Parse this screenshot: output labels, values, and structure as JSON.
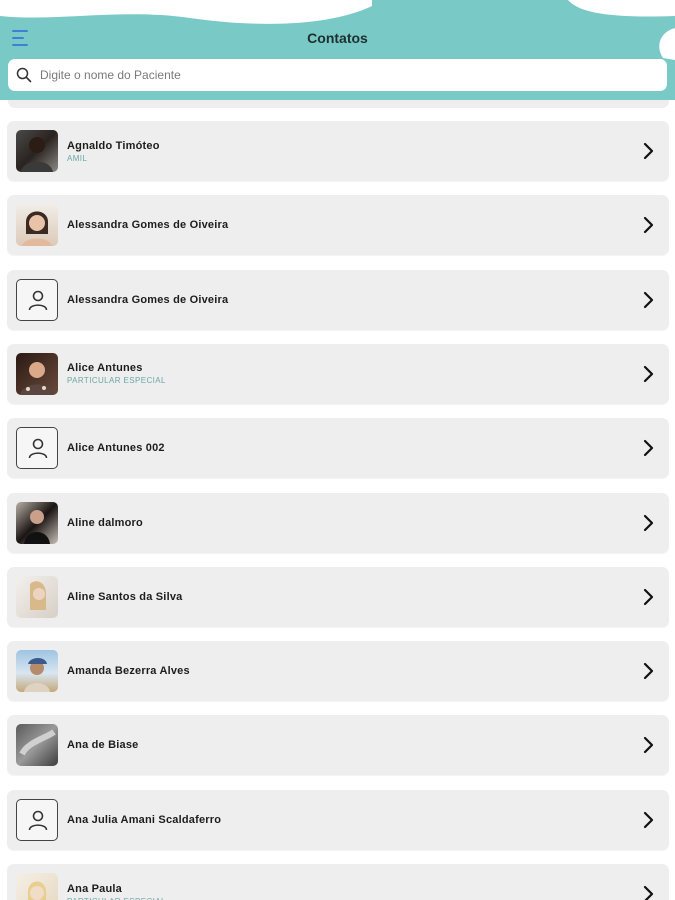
{
  "header": {
    "title": "Contatos",
    "accent_color": "#79c9c6",
    "menu_icon": "hamburger-menu-icon"
  },
  "search": {
    "placeholder": "Digite o nome do Paciente",
    "value": ""
  },
  "contacts": [
    {
      "name": "Agnaldo Timóteo",
      "plan": "AMIL",
      "avatar": "photo"
    },
    {
      "name": "Alessandra Gomes de Oiveira",
      "plan": "",
      "avatar": "photo"
    },
    {
      "name": "Alessandra Gomes de Oiveira",
      "plan": "",
      "avatar": "placeholder"
    },
    {
      "name": "Alice Antunes",
      "plan": "PARTICULAR ESPECIAL",
      "avatar": "photo"
    },
    {
      "name": "Alice Antunes 002",
      "plan": "",
      "avatar": "placeholder"
    },
    {
      "name": "Aline dalmoro",
      "plan": "",
      "avatar": "photo"
    },
    {
      "name": "Aline Santos da Silva",
      "plan": "",
      "avatar": "photo"
    },
    {
      "name": "Amanda Bezerra Alves",
      "plan": "",
      "avatar": "photo"
    },
    {
      "name": "Ana de Biase",
      "plan": "",
      "avatar": "photo"
    },
    {
      "name": "Ana Julia Amani Scaldaferro",
      "plan": "",
      "avatar": "placeholder"
    },
    {
      "name": "Ana Paula",
      "plan": "PARTICULAR ESPECIAL",
      "avatar": "photo"
    }
  ]
}
